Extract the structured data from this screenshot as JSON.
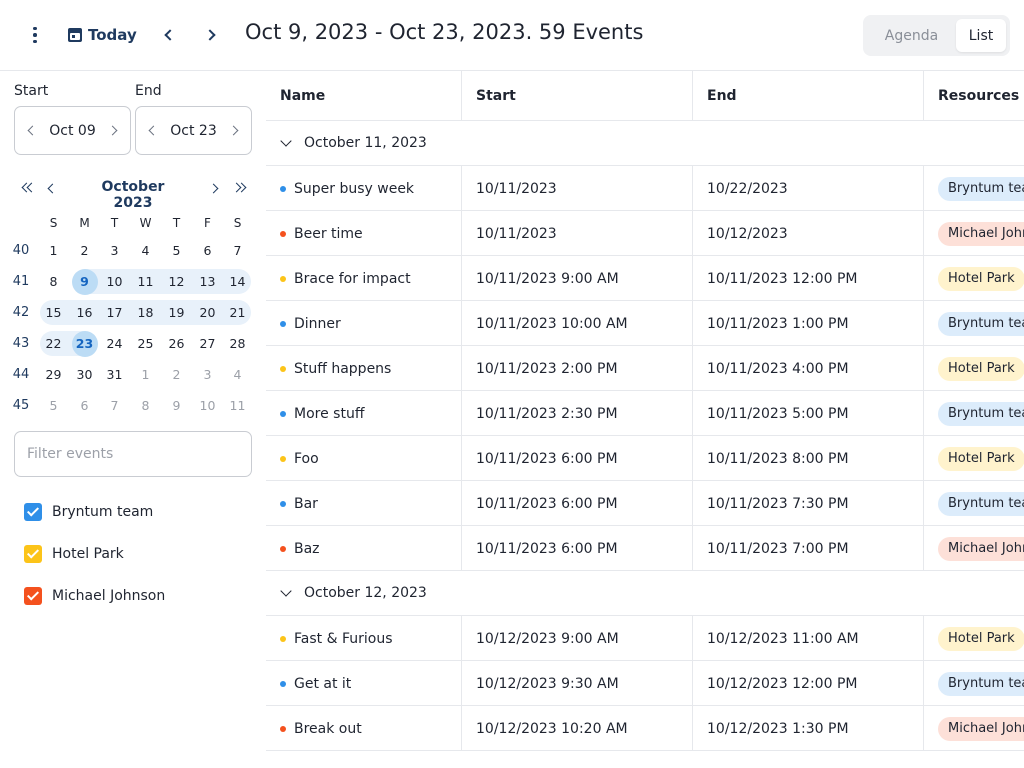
{
  "toolbar": {
    "today_label": "Today",
    "title": "Oct 9, 2023 - Oct 23, 2023. 59 Events",
    "views": [
      "Agenda",
      "List"
    ],
    "active_view": "List"
  },
  "range": {
    "start_label": "Start",
    "start_value": "Oct 09",
    "end_label": "End",
    "end_value": "Oct 23"
  },
  "calendar": {
    "month_label": "October 2023",
    "dow": [
      "S",
      "M",
      "T",
      "W",
      "T",
      "F",
      "S"
    ],
    "weeks": [
      {
        "num": "40",
        "days": [
          "1",
          "2",
          "3",
          "4",
          "5",
          "6",
          "7"
        ]
      },
      {
        "num": "41",
        "days": [
          "8",
          "9",
          "10",
          "11",
          "12",
          "13",
          "14"
        ]
      },
      {
        "num": "42",
        "days": [
          "15",
          "16",
          "17",
          "18",
          "19",
          "20",
          "21"
        ]
      },
      {
        "num": "43",
        "days": [
          "22",
          "23",
          "24",
          "25",
          "26",
          "27",
          "28"
        ]
      },
      {
        "num": "44",
        "days": [
          "29",
          "30",
          "31",
          "1",
          "2",
          "3",
          "4"
        ]
      },
      {
        "num": "45",
        "days": [
          "5",
          "6",
          "7",
          "8",
          "9",
          "10",
          "11"
        ]
      }
    ]
  },
  "filter": {
    "placeholder": "Filter events"
  },
  "resources": [
    {
      "label": "Bryntum team",
      "color": "#2f8fe8"
    },
    {
      "label": "Hotel Park",
      "color": "#fcc419"
    },
    {
      "label": "Michael Johnson",
      "color": "#f4511e"
    }
  ],
  "grid": {
    "columns": [
      "Name",
      "Start",
      "End",
      "Resources"
    ],
    "groups": [
      {
        "label": "October 11, 2023",
        "rows": [
          {
            "name": "Super busy week",
            "start": "10/11/2023",
            "end": "10/22/2023",
            "resource": "Bryntum team",
            "dot": "#2f8fe8",
            "chip_bg": "#dcecfb"
          },
          {
            "name": "Beer time",
            "start": "10/11/2023",
            "end": "10/12/2023",
            "resource": "Michael Johnson",
            "dot": "#f4511e",
            "chip_bg": "#fde0d8"
          },
          {
            "name": "Brace for impact",
            "start": "10/11/2023 9:00 AM",
            "end": "10/11/2023 12:00 PM",
            "resource": "Hotel Park",
            "dot": "#fcc419",
            "chip_bg": "#fff3cd"
          },
          {
            "name": "Dinner",
            "start": "10/11/2023 10:00 AM",
            "end": "10/11/2023 1:00 PM",
            "resource": "Bryntum team",
            "dot": "#2f8fe8",
            "chip_bg": "#dcecfb"
          },
          {
            "name": "Stuff happens",
            "start": "10/11/2023 2:00 PM",
            "end": "10/11/2023 4:00 PM",
            "resource": "Hotel Park",
            "dot": "#fcc419",
            "chip_bg": "#fff3cd"
          },
          {
            "name": "More stuff",
            "start": "10/11/2023 2:30 PM",
            "end": "10/11/2023 5:00 PM",
            "resource": "Bryntum team",
            "dot": "#2f8fe8",
            "chip_bg": "#dcecfb"
          },
          {
            "name": "Foo",
            "start": "10/11/2023 6:00 PM",
            "end": "10/11/2023 8:00 PM",
            "resource": "Hotel Park",
            "dot": "#fcc419",
            "chip_bg": "#fff3cd"
          },
          {
            "name": "Bar",
            "start": "10/11/2023 6:00 PM",
            "end": "10/11/2023 7:30 PM",
            "resource": "Bryntum team",
            "dot": "#2f8fe8",
            "chip_bg": "#dcecfb"
          },
          {
            "name": "Baz",
            "start": "10/11/2023 6:00 PM",
            "end": "10/11/2023 7:00 PM",
            "resource": "Michael Johnson",
            "dot": "#f4511e",
            "chip_bg": "#fde0d8"
          }
        ]
      },
      {
        "label": "October 12, 2023",
        "rows": [
          {
            "name": "Fast & Furious",
            "start": "10/12/2023 9:00 AM",
            "end": "10/12/2023 11:00 AM",
            "resource": "Hotel Park",
            "dot": "#fcc419",
            "chip_bg": "#fff3cd"
          },
          {
            "name": "Get at it",
            "start": "10/12/2023 9:30 AM",
            "end": "10/12/2023 12:00 PM",
            "resource": "Bryntum team",
            "dot": "#2f8fe8",
            "chip_bg": "#dcecfb"
          },
          {
            "name": "Break out",
            "start": "10/12/2023 10:20 AM",
            "end": "10/12/2023 1:30 PM",
            "resource": "Michael Johnson",
            "dot": "#f4511e",
            "chip_bg": "#fde0d8"
          }
        ]
      }
    ]
  }
}
